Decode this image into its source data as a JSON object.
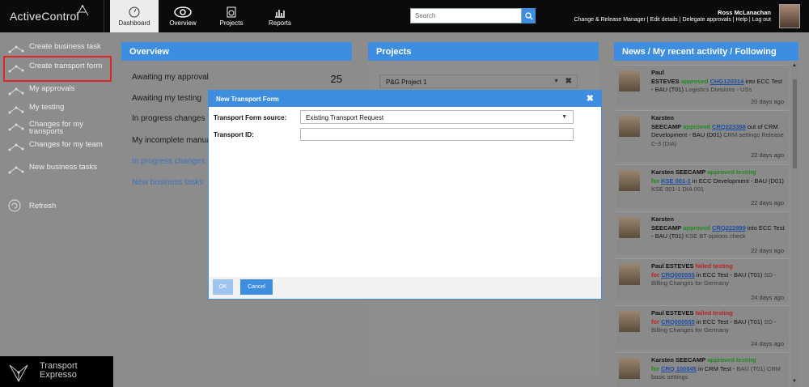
{
  "app": {
    "brand": "ActiveControl"
  },
  "nav": [
    {
      "label": "Dashboard",
      "icon": "dashboard-icon",
      "active": true
    },
    {
      "label": "Overview",
      "icon": "eye-icon"
    },
    {
      "label": "Projects",
      "icon": "projects-icon"
    },
    {
      "label": "Reports",
      "icon": "reports-icon"
    }
  ],
  "search": {
    "placeholder": "Search"
  },
  "user": {
    "name": "Ross McLanachan",
    "links": "Change & Release Manager | Edit details | Delegate approvals | Help | Log out"
  },
  "sidebar": {
    "items": [
      {
        "label": "Create business task"
      },
      {
        "label": "Create transport form"
      },
      {
        "label": "My approvals"
      },
      {
        "label": "My testing"
      },
      {
        "label": "Changes for my transports"
      },
      {
        "label": "Changes for my team"
      },
      {
        "label": "New business tasks"
      }
    ],
    "refresh": "Refresh",
    "footer": {
      "line1": "Transport",
      "line2": "Expresso"
    }
  },
  "overview": {
    "title": "Overview",
    "rows": [
      {
        "label": "Awaiting my approval"
      },
      {
        "label": "Awaiting my testing"
      },
      {
        "label": "In progress changes fo"
      },
      {
        "label": "My incomplete manual"
      },
      {
        "label": "In progress changes fo"
      },
      {
        "label": "New business tasks"
      }
    ],
    "approval_count": "25"
  },
  "projects": {
    "title": "Projects",
    "selected": "P&G Project 1"
  },
  "news": {
    "title": "News / My recent activity / Following",
    "items": [
      {
        "who1": "Paul",
        "who2": "ESTEVES",
        "action": "approved",
        "ref": "CHG120314",
        "rest": " into ECC Test - BAU (T01)",
        "detail": "Logistics Divisions - USs",
        "ago": "20 days ago"
      },
      {
        "who1": "Karsten",
        "who2": "SEECAMP",
        "action": "approved",
        "ref": "CRQ223388",
        "rest": " out of CRM Development - BAU (D01)",
        "detail": "CRM settings Release C-3 (DIA)",
        "ago": "22 days ago"
      },
      {
        "who1": "Karsten SEECAMP",
        "who2": "",
        "action": "approved testing",
        "pre": "for ",
        "ref": "KSE 001-1",
        "rest": " in ECC Development - BAU (D01)",
        "detail": "KSE 001-1 DIA 001",
        "ago": "22 days ago"
      },
      {
        "who1": "Karsten",
        "who2": "SEECAMP",
        "action": "approved",
        "ref": "CRQ222999",
        "rest": " into ECC Test - BAU (T01)",
        "detail": "KSE BT options check",
        "ago": "22 days ago"
      },
      {
        "who1": "Paul ESTEVES",
        "who2": "",
        "action": "failed testing",
        "pre": "for ",
        "ref": "CRQ000555",
        "rest": " in ECC Test - BAU (T01)",
        "detail": "SD - Billing Changes for Germany",
        "ago": "24 days ago"
      },
      {
        "who1": "Paul ESTEVES",
        "who2": "",
        "action": "failed testing",
        "pre": "for ",
        "ref": "CRQ000555",
        "rest": " in ECC Test - BAU (T01)",
        "detail": "SD - Billing Changes for Germany",
        "ago": "24 days ago"
      },
      {
        "who1": "Karsten SEECAMP",
        "who2": "",
        "action": "approved testing",
        "pre": "for ",
        "ref": "CRQ 100045",
        "rest": " in CRM Test -",
        "detail": "BAU (T01) CRM basic settings",
        "ago": ""
      }
    ]
  },
  "modal": {
    "title": "New Transport Form",
    "source_label": "Transport Form source:",
    "source_value": "Existing Transport Request",
    "id_label": "Transport ID:",
    "id_value": "",
    "ok": "OK",
    "cancel": "Cancel"
  },
  "colors": {
    "accent": "#3d8de0",
    "highlight": "#e0262b",
    "approved": "#1f8a1f",
    "failed": "#b22222"
  }
}
